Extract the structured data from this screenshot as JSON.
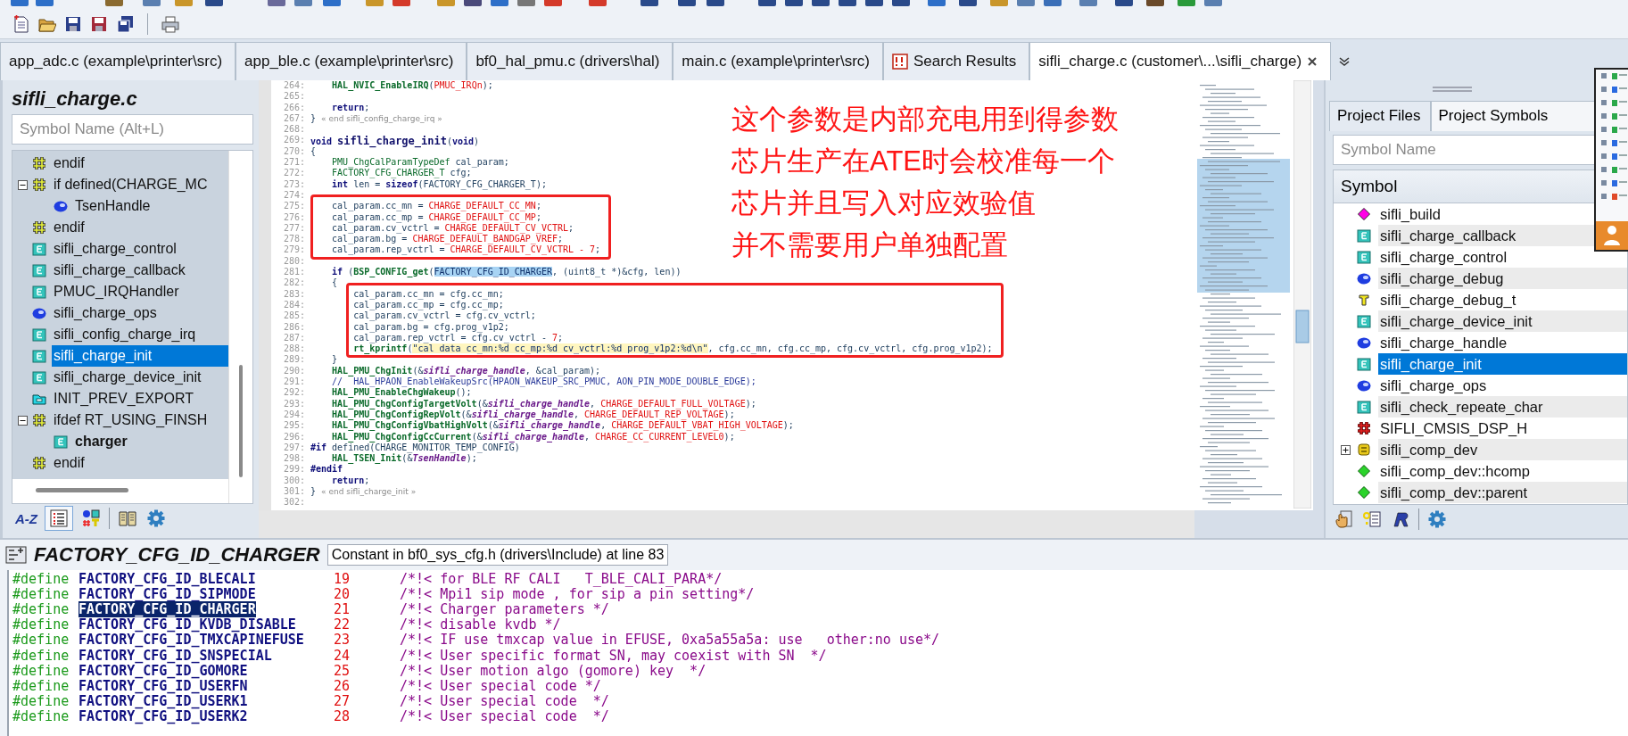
{
  "tabs": [
    {
      "label": "app_adc.c (example\\printer\\src)",
      "kind": "file",
      "selected": false
    },
    {
      "label": "app_ble.c (example\\printer\\src)",
      "kind": "file",
      "selected": false
    },
    {
      "label": "bf0_hal_pmu.c (drivers\\hal)",
      "kind": "file",
      "selected": false
    },
    {
      "label": "main.c (example\\printer\\src)",
      "kind": "file",
      "selected": false
    },
    {
      "label": "Search Results",
      "kind": "results",
      "selected": false
    },
    {
      "label": "sifli_charge.c (customer\\...\\sifli_charge)",
      "kind": "file",
      "selected": true
    }
  ],
  "outline": {
    "title": "sifli_charge.c",
    "search": {
      "placeholder": "Symbol Name (Alt+L)"
    },
    "items": [
      {
        "name": "endif",
        "kind": "preproc",
        "selected": false,
        "bold": false
      },
      {
        "name": "if defined(CHARGE_MC",
        "kind": "preproc",
        "selected": false,
        "bold": false,
        "expanded": true,
        "children": [
          {
            "name": "TsenHandle",
            "kind": "variable",
            "selected": false,
            "bold": false
          }
        ]
      },
      {
        "name": "endif",
        "kind": "preproc",
        "selected": false,
        "bold": false
      },
      {
        "name": "sifli_charge_control",
        "kind": "function",
        "selected": false,
        "bold": false
      },
      {
        "name": "sifli_charge_callback",
        "kind": "function",
        "selected": false,
        "bold": false
      },
      {
        "name": "PMUC_IRQHandler",
        "kind": "function",
        "selected": false,
        "bold": false
      },
      {
        "name": "sifli_charge_ops",
        "kind": "variable",
        "selected": false,
        "bold": false
      },
      {
        "name": "sifli_config_charge_irq",
        "kind": "function",
        "selected": false,
        "bold": false
      },
      {
        "name": "sifli_charge_init",
        "kind": "function",
        "selected": true,
        "bold": false
      },
      {
        "name": "sifli_charge_device_init",
        "kind": "function",
        "selected": false,
        "bold": false
      },
      {
        "name": "INIT_PREV_EXPORT",
        "kind": "export",
        "selected": false,
        "bold": false
      },
      {
        "name": "ifdef RT_USING_FINSH",
        "kind": "preproc",
        "selected": false,
        "bold": false,
        "expanded": true,
        "children": [
          {
            "name": "charger",
            "kind": "function",
            "selected": false,
            "bold": true
          }
        ]
      },
      {
        "name": "endif",
        "kind": "preproc",
        "selected": false,
        "bold": false
      }
    ],
    "toolbar": [
      {
        "kind": "sort",
        "label": "A-Z",
        "pressed": false
      },
      {
        "kind": "list",
        "pressed": true
      },
      {
        "kind": "types",
        "pressed": false
      },
      {
        "kind": "book",
        "pressed": false
      },
      {
        "kind": "settings",
        "pressed": false
      }
    ]
  },
  "editor": {
    "blocks": [
      {
        "boxed": false,
        "lines": [
          {
            "number": "264:",
            "segments": [
              {
                "kind": "func",
                "text": "    HAL_NVIC_EnableIRQ"
              },
              {
                "kind": "plain",
                "text": "("
              },
              {
                "kind": "macro",
                "text": "PMUC_IRQn"
              },
              {
                "kind": "plain",
                "text": ");"
              }
            ]
          },
          {
            "number": "265:"
          },
          {
            "number": "266:",
            "segments": [
              {
                "kind": "kw",
                "text": "    return"
              },
              {
                "kind": "plain",
                "text": ";"
              }
            ]
          },
          {
            "number": "267:",
            "segments": [
              {
                "kind": "plain",
                "text": "} "
              },
              {
                "kind": "end",
                "text": "« end sifli_config_charge_irq »"
              }
            ]
          },
          {
            "number": "268:"
          },
          {
            "number": "269:",
            "segments": [
              {
                "kind": "kw",
                "text": "void "
              },
              {
                "kind": "decl",
                "text": "sifli_charge_init"
              },
              {
                "kind": "plain",
                "text": "("
              },
              {
                "kind": "kw",
                "text": "void"
              },
              {
                "kind": "plain",
                "text": ")"
              }
            ]
          },
          {
            "number": "270:",
            "segments": [
              {
                "kind": "plain",
                "text": "{"
              }
            ]
          },
          {
            "number": "271:",
            "segments": [
              {
                "kind": "type",
                "text": "    PMU_ChgCalParamTypeDef"
              },
              {
                "kind": "plain",
                "text": " cal_param;"
              }
            ]
          },
          {
            "number": "272:",
            "segments": [
              {
                "kind": "type",
                "text": "    FACTORY_CFG_CHARGER_T"
              },
              {
                "kind": "plain",
                "text": " cfg;"
              }
            ]
          },
          {
            "number": "273:",
            "segments": [
              {
                "kind": "kw",
                "text": "    int"
              },
              {
                "kind": "plain",
                "text": " len = "
              },
              {
                "kind": "kw",
                "text": "sizeof"
              },
              {
                "kind": "plain",
                "text": "(FACTORY_CFG_CHARGER_T);"
              }
            ]
          },
          {
            "number": "274:"
          }
        ]
      },
      {
        "boxed": true,
        "lines": [
          {
            "number": "275:",
            "segments": [
              {
                "kind": "plain",
                "text": "    cal_param.cc_mn = "
              },
              {
                "kind": "macro",
                "text": "CHARGE_DEFAULT_CC_MN"
              },
              {
                "kind": "plain",
                "text": ";"
              }
            ]
          },
          {
            "number": "276:",
            "segments": [
              {
                "kind": "plain",
                "text": "    cal_param.cc_mp = "
              },
              {
                "kind": "macro",
                "text": "CHARGE_DEFAULT_CC_MP"
              },
              {
                "kind": "plain",
                "text": ";"
              }
            ]
          },
          {
            "number": "277:",
            "segments": [
              {
                "kind": "plain",
                "text": "    cal_param.cv_vctrl = "
              },
              {
                "kind": "macro",
                "text": "CHARGE_DEFAULT_CV_VCTRL"
              },
              {
                "kind": "plain",
                "text": ";"
              }
            ]
          },
          {
            "number": "278:",
            "segments": [
              {
                "kind": "plain",
                "text": "    cal_param.bg = "
              },
              {
                "kind": "macro",
                "text": "CHARGE_DEFAULT_BANDGAP_VREF"
              },
              {
                "kind": "plain",
                "text": ";"
              }
            ]
          },
          {
            "number": "279:",
            "segments": [
              {
                "kind": "plain",
                "text": "    cal_param.rep_vctrl = "
              },
              {
                "kind": "macro",
                "text": "CHARGE_DEFAULT_CV_VCTRL - 7"
              },
              {
                "kind": "plain",
                "text": ";"
              }
            ]
          }
        ]
      },
      {
        "boxed": false,
        "lines": [
          {
            "number": "280:"
          },
          {
            "number": "281:",
            "segments": [
              {
                "kind": "kw",
                "text": "    if"
              },
              {
                "kind": "plain",
                "text": " ("
              },
              {
                "kind": "func",
                "text": "BSP_CONFIG_get"
              },
              {
                "kind": "plain",
                "text": "("
              },
              {
                "kind": "hl",
                "text": "FACTORY_CFG_ID_CHARGER"
              },
              {
                "kind": "plain",
                "text": ", (uint8_t *)&cfg, len))"
              }
            ]
          },
          {
            "number": "282:",
            "segments": [
              {
                "kind": "plain",
                "text": "    {"
              }
            ]
          }
        ]
      },
      {
        "boxed": true,
        "lines": [
          {
            "number": "283:",
            "segments": [
              {
                "kind": "plain",
                "text": "        cal_param.cc_mn = cfg.cc_mn;"
              }
            ]
          },
          {
            "number": "284:",
            "segments": [
              {
                "kind": "plain",
                "text": "        cal_param.cc_mp = cfg.cc_mp;"
              }
            ]
          },
          {
            "number": "285:",
            "segments": [
              {
                "kind": "plain",
                "text": "        cal_param.cv_vctrl = cfg.cv_vctrl;"
              }
            ]
          },
          {
            "number": "286:",
            "segments": [
              {
                "kind": "plain",
                "text": "        cal_param.bg = cfg.prog_v1p2;"
              }
            ]
          },
          {
            "number": "287:",
            "segments": [
              {
                "kind": "plain",
                "text": "        cal_param.rep_vctrl = cfg.cv_vctrl - "
              },
              {
                "kind": "macro",
                "text": "7"
              },
              {
                "kind": "plain",
                "text": ";"
              }
            ]
          },
          {
            "number": "288:",
            "segments": [
              {
                "kind": "func",
                "text": "        rt_kprintf"
              },
              {
                "kind": "plain",
                "text": "("
              },
              {
                "kind": "str",
                "text": "\"cal data cc_mn:%d cc_mp:%d cv_vctrl:%d prog_v1p2:%d\\n\""
              },
              {
                "kind": "plain",
                "text": ", cfg.cc_mn, cfg.cc_mp, cfg.cv_vctrl, cfg.prog_v1p2);"
              }
            ]
          }
        ]
      },
      {
        "boxed": false,
        "lines": [
          {
            "number": "289:",
            "segments": [
              {
                "kind": "plain",
                "text": "    }"
              }
            ]
          },
          {
            "number": "290:",
            "segments": [
              {
                "kind": "func",
                "text": "    HAL_PMU_ChgInit"
              },
              {
                "kind": "plain",
                "text": "(&"
              },
              {
                "kind": "ital",
                "text": "sifli_charge_handle"
              },
              {
                "kind": "plain",
                "text": ", &cal_param);"
              }
            ]
          },
          {
            "number": "291:",
            "segments": [
              {
                "kind": "cmt",
                "text": "    //  HAL_HPAON_EnableWakeupSrc(HPAON_WAKEUP_SRC_PMUC, AON_PIN_MODE_DOUBLE_EDGE);"
              }
            ]
          },
          {
            "number": "292:",
            "segments": [
              {
                "kind": "func",
                "text": "    HAL_PMU_EnableChgWakeup"
              },
              {
                "kind": "plain",
                "text": "();"
              }
            ]
          },
          {
            "number": "293:",
            "segments": [
              {
                "kind": "func",
                "text": "    HAL_PMU_ChgConfigTargetVolt"
              },
              {
                "kind": "plain",
                "text": "(&"
              },
              {
                "kind": "ital",
                "text": "sifli_charge_handle"
              },
              {
                "kind": "plain",
                "text": ", "
              },
              {
                "kind": "macro",
                "text": "CHARGE_DEFAULT_FULL_VOLTAGE"
              },
              {
                "kind": "plain",
                "text": ");"
              }
            ]
          },
          {
            "number": "294:",
            "segments": [
              {
                "kind": "func",
                "text": "    HAL_PMU_ChgConfigRepVolt"
              },
              {
                "kind": "plain",
                "text": "(&"
              },
              {
                "kind": "ital",
                "text": "sifli_charge_handle"
              },
              {
                "kind": "plain",
                "text": ", "
              },
              {
                "kind": "macro",
                "text": "CHARGE_DEFAULT_REP_VOLTAGE"
              },
              {
                "kind": "plain",
                "text": ");"
              }
            ]
          },
          {
            "number": "295:",
            "segments": [
              {
                "kind": "func",
                "text": "    HAL_PMU_ChgConfigVbatHighVolt"
              },
              {
                "kind": "plain",
                "text": "(&"
              },
              {
                "kind": "ital",
                "text": "sifli_charge_handle"
              },
              {
                "kind": "plain",
                "text": ", "
              },
              {
                "kind": "macro",
                "text": "CHARGE_DEFAULT_VBAT_HIGH_VOLTAGE"
              },
              {
                "kind": "plain",
                "text": ");"
              }
            ]
          },
          {
            "number": "296:",
            "segments": [
              {
                "kind": "func",
                "text": "    HAL_PMU_ChgConfigCcCurrent"
              },
              {
                "kind": "plain",
                "text": "(&"
              },
              {
                "kind": "ital",
                "text": "sifli_charge_handle"
              },
              {
                "kind": "plain",
                "text": ", "
              },
              {
                "kind": "macro",
                "text": "CHARGE_CC_CURRENT_LEVEL0"
              },
              {
                "kind": "plain",
                "text": ");"
              }
            ]
          },
          {
            "number": "297:",
            "segments": [
              {
                "kind": "kw",
                "text": "#if"
              },
              {
                "kind": "plain",
                "text": " defined(CHARGE_MONITOR_TEMP_CONFIG)"
              }
            ]
          },
          {
            "number": "298:",
            "segments": [
              {
                "kind": "func",
                "text": "    HAL_TSEN_Init"
              },
              {
                "kind": "plain",
                "text": "(&"
              },
              {
                "kind": "ital",
                "text": "TsenHandle"
              },
              {
                "kind": "plain",
                "text": ");"
              }
            ]
          },
          {
            "number": "299:",
            "segments": [
              {
                "kind": "kw",
                "text": "#endif"
              }
            ]
          },
          {
            "number": "300:",
            "segments": [
              {
                "kind": "kw",
                "text": "    return"
              },
              {
                "kind": "plain",
                "text": ";"
              }
            ]
          },
          {
            "number": "301:",
            "segments": [
              {
                "kind": "plain",
                "text": "} "
              },
              {
                "kind": "end",
                "text": "« end sifli_charge_init »"
              }
            ]
          },
          {
            "number": "302:"
          }
        ]
      }
    ],
    "annotation": {
      "lines": [
        "这个参数是内部充电用到得参数",
        "芯片生产在ATE时会校准每一个",
        "芯片并且写入对应效验值",
        "并不需要用户单独配置"
      ]
    }
  },
  "symbol_browser": {
    "tabs": [
      {
        "label": "Project Files",
        "selected": false
      },
      {
        "label": "Project Symbols",
        "selected": true
      }
    ],
    "search": {
      "placeholder": "Symbol Name"
    },
    "column": "Symbol",
    "rows": [
      {
        "name": "sifli_build",
        "kind": "define",
        "selected": false
      },
      {
        "name": "sifli_charge_callback",
        "kind": "function",
        "selected": false
      },
      {
        "name": "sifli_charge_control",
        "kind": "function",
        "selected": false
      },
      {
        "name": "sifli_charge_debug",
        "kind": "variable",
        "selected": false
      },
      {
        "name": "sifli_charge_debug_t",
        "kind": "typedef",
        "selected": false
      },
      {
        "name": "sifli_charge_device_init",
        "kind": "function",
        "selected": false
      },
      {
        "name": "sifli_charge_handle",
        "kind": "variable",
        "selected": false
      },
      {
        "name": "sifli_charge_init",
        "kind": "function",
        "selected": true
      },
      {
        "name": "sifli_charge_ops",
        "kind": "variable",
        "selected": false
      },
      {
        "name": "sifli_check_repeate_char",
        "kind": "function",
        "selected": false
      },
      {
        "name": "SIFLI_CMSIS_DSP_H",
        "kind": "guard",
        "selected": false
      },
      {
        "name": "sifli_comp_dev",
        "kind": "struct",
        "selected": false,
        "expanded": false
      },
      {
        "name": "sifli_comp_dev::hcomp",
        "kind": "member",
        "selected": false
      },
      {
        "name": "sifli_comp_dev::parent",
        "kind": "member",
        "selected": false
      }
    ],
    "toolbar": [
      {
        "kind": "hand"
      },
      {
        "kind": "help"
      },
      {
        "kind": "script"
      },
      {
        "kind": "settings"
      }
    ]
  },
  "symbol_info": {
    "title": "FACTORY_CFG_ID_CHARGER",
    "description": "Constant in bf0_sys_cfg.h (drivers\\Include) at line 83",
    "rows": [
      {
        "directive": "#define",
        "name": "FACTORY_CFG_ID_BLECALI",
        "value": "19",
        "comment": "/*!< for BLE RF CALI   T_BLE_CALI_PARA*/",
        "selected": false
      },
      {
        "directive": "#define",
        "name": "FACTORY_CFG_ID_SIPMODE",
        "value": "20",
        "comment": "/*!< Mpi1 sip mode , for sip a pin setting*/",
        "selected": false
      },
      {
        "directive": "#define",
        "name": "FACTORY_CFG_ID_CHARGER",
        "value": "21",
        "comment": "/*!< Charger parameters */",
        "selected": true
      },
      {
        "directive": "#define",
        "name": "FACTORY_CFG_ID_KVDB_DISABLE",
        "value": "22",
        "comment": "/*!< disable kvdb */",
        "selected": false
      },
      {
        "directive": "#define",
        "name": "FACTORY_CFG_ID_TMXCAPINEFUSE",
        "value": "23",
        "comment": "/*!< IF use tmxcap value in EFUSE, 0xa5a55a5a: use   other:no use*/",
        "selected": false
      },
      {
        "directive": "#define",
        "name": "FACTORY_CFG_ID_SNSPECIAL",
        "value": "24",
        "comment": "/*!< User specific format SN, may coexist with SN  */",
        "selected": false
      },
      {
        "directive": "#define",
        "name": "FACTORY_CFG_ID_GOMORE",
        "value": "25",
        "comment": "/*!< User motion algo (gomore) key  */",
        "selected": false
      },
      {
        "directive": "#define",
        "name": "FACTORY_CFG_ID_USERFN",
        "value": "26",
        "comment": "/*!< User special code */",
        "selected": false
      },
      {
        "directive": "#define",
        "name": "FACTORY_CFG_ID_USERK1",
        "value": "27",
        "comment": "/*!< User special code  */",
        "selected": false
      },
      {
        "directive": "#define",
        "name": "FACTORY_CFG_ID_USERK2",
        "value": "28",
        "comment": "/*!< User special code  */",
        "selected": false
      }
    ]
  }
}
